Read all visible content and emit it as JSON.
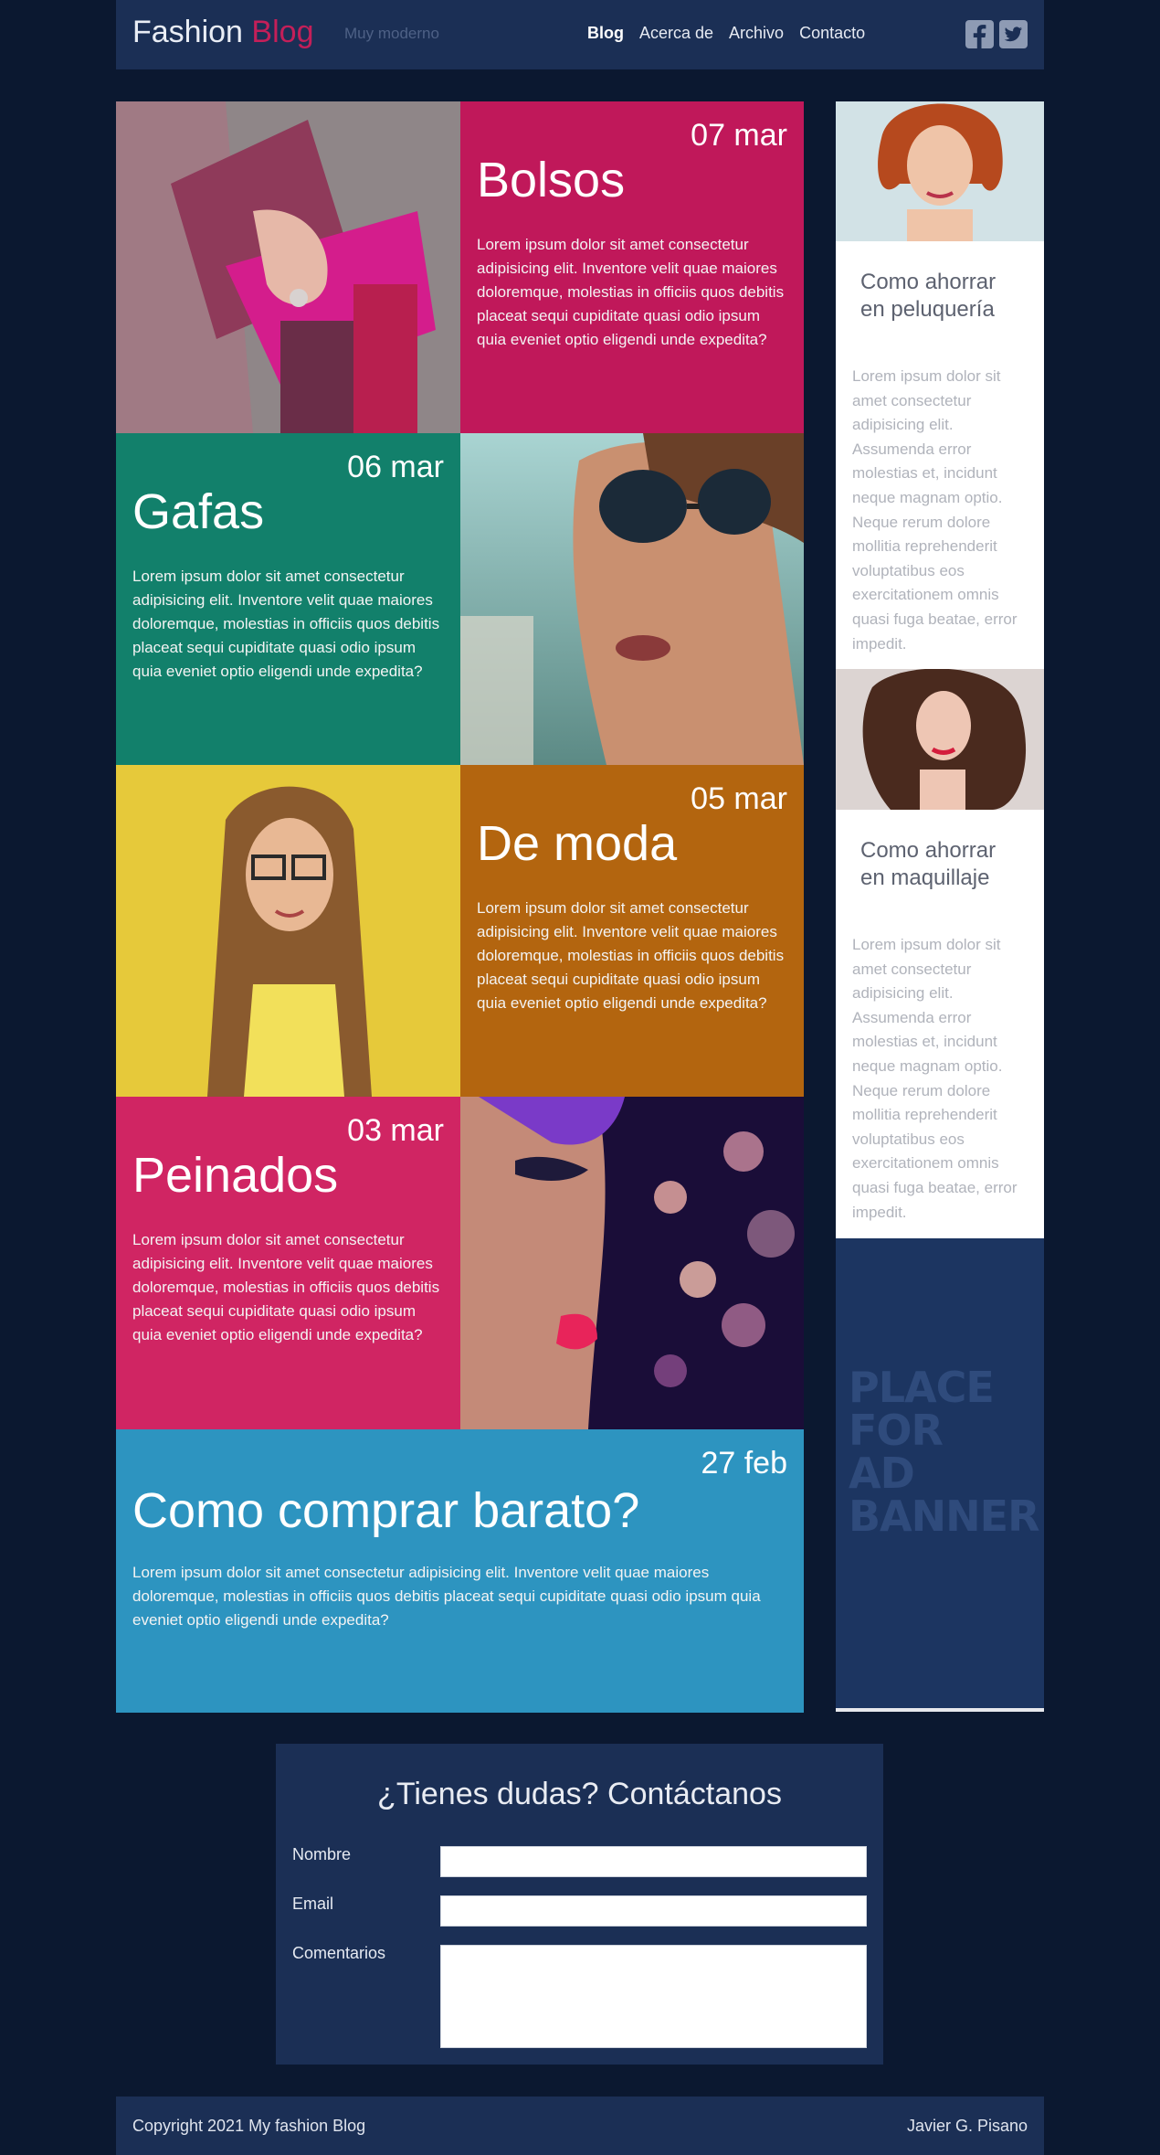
{
  "header": {
    "logo_main": "Fashion",
    "logo_accent": "Blog",
    "tagline": "Muy moderno",
    "nav": [
      "Blog",
      "Acerca de",
      "Archivo",
      "Contacto"
    ],
    "social": [
      "facebook-icon",
      "twitter-icon"
    ]
  },
  "posts": [
    {
      "date": "07 mar",
      "title": "Bolsos",
      "color": "#c0185a",
      "text": "Lorem ipsum dolor sit amet consectetur adipisicing elit. Inventore velit quae maiores doloremque, molestias in officiis quos debitis placeat sequi cupiditate quasi odio ipsum quia eveniet optio eligendi unde expedita?"
    },
    {
      "date": "06 mar",
      "title": "Gafas",
      "color": "#12806b",
      "text": "Lorem ipsum dolor sit amet consectetur adipisicing elit. Inventore velit quae maiores doloremque, molestias in officiis quos debitis placeat sequi cupiditate quasi odio ipsum quia eveniet optio eligendi unde expedita?"
    },
    {
      "date": "05 mar",
      "title": "De moda",
      "color": "#b3650f",
      "text": "Lorem ipsum dolor sit amet consectetur adipisicing elit. Inventore velit quae maiores doloremque, molestias in officiis quos debitis placeat sequi cupiditate quasi odio ipsum quia eveniet optio eligendi unde expedita?"
    },
    {
      "date": "03 mar",
      "title": "Peinados",
      "color": "#d02563",
      "text": "Lorem ipsum dolor sit amet consectetur adipisicing elit. Inventore velit quae maiores doloremque, molestias in officiis quos debitis placeat sequi cupiditate quasi odio ipsum quia eveniet optio eligendi unde expedita?"
    },
    {
      "date": "27 feb",
      "title": "Como comprar barato?",
      "color": "#2d94c0",
      "text": "Lorem ipsum dolor sit amet consectetur adipisicing elit. Inventore velit quae maiores doloremque, molestias in officiis quos debitis placeat sequi cupiditate quasi odio ipsum quia eveniet optio eligendi unde expedita?"
    }
  ],
  "sidebar": {
    "cards": [
      {
        "title_l1": "Como ahorrar",
        "title_l2": "en peluquería",
        "text": "Lorem ipsum dolor sit amet consectetur adipisicing elit. Assumenda error molestias et, incidunt neque magnam optio. Neque rerum dolore mollitia reprehenderit voluptatibus eos exercitationem omnis quasi fuga beatae, error impedit."
      },
      {
        "title_l1": "Como ahorrar",
        "title_l2": "en maquillaje",
        "text": "Lorem ipsum dolor sit amet consectetur adipisicing elit. Assumenda error molestias et, incidunt neque magnam optio. Neque rerum dolore mollitia reprehenderit voluptatibus eos exercitationem omnis quasi fuga beatae, error impedit."
      }
    ],
    "ad_lines": [
      "PLACE",
      "FOR",
      "AD",
      "BANNER"
    ]
  },
  "contact": {
    "title": "¿Tienes dudas? Contáctanos",
    "label_name": "Nombre",
    "label_email": "Email",
    "label_comments": "Comentarios"
  },
  "footer": {
    "copyright": "Copyright 2021 My fashion Blog",
    "author": "Javier G. Pisano"
  }
}
